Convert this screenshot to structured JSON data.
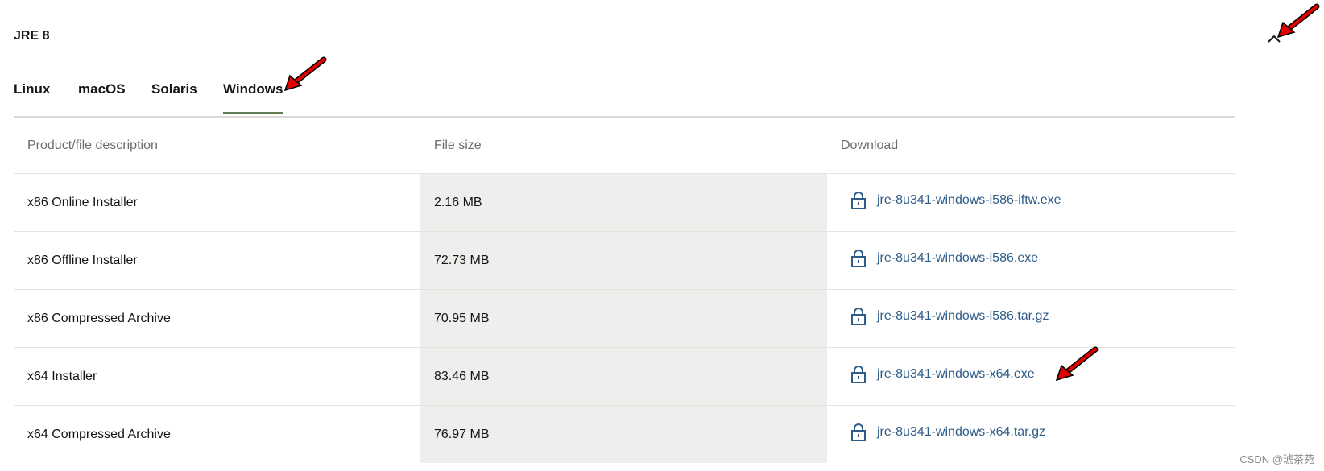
{
  "section": {
    "title": "JRE 8"
  },
  "tabs": [
    {
      "label": "Linux",
      "active": false
    },
    {
      "label": "macOS",
      "active": false
    },
    {
      "label": "Solaris",
      "active": false
    },
    {
      "label": "Windows",
      "active": true
    }
  ],
  "table": {
    "headers": [
      "Product/file description",
      "File size",
      "Download"
    ],
    "rows": [
      {
        "description": "x86 Online Installer",
        "size": "2.16 MB",
        "file": "jre-8u341-windows-i586-iftw.exe"
      },
      {
        "description": "x86 Offline Installer",
        "size": "72.73 MB",
        "file": "jre-8u341-windows-i586.exe"
      },
      {
        "description": "x86 Compressed Archive",
        "size": "70.95 MB",
        "file": "jre-8u341-windows-i586.tar.gz"
      },
      {
        "description": "x64 Installer",
        "size": "83.46 MB",
        "file": "jre-8u341-windows-x64.exe"
      },
      {
        "description": "x64 Compressed Archive",
        "size": "76.97 MB",
        "file": "jre-8u341-windows-x64.tar.gz"
      }
    ]
  },
  "icons": {
    "collapse": "chevron-up-icon",
    "download": "lock-icon",
    "annotation": "red-arrow-icon"
  },
  "colors": {
    "link": "#2f5d8a",
    "active_tab_underline": "#5f7d4f",
    "size_column_bg": "#efeeec",
    "annotation_arrow": "#e00000"
  },
  "watermark": "CSDN @琥茶菀"
}
